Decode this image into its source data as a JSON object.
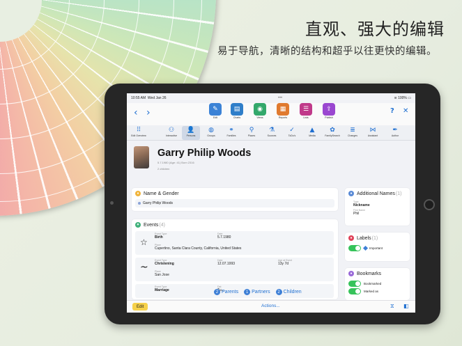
{
  "promo": {
    "headline": "直观、强大的编辑",
    "subline": "易于导航，清晰的结构和超乎以往更快的编辑。"
  },
  "status_bar": {
    "time": "10:55 AM",
    "date": "Wed Jan 26",
    "battery": "100%"
  },
  "toolbar": {
    "items": [
      {
        "label": "Edit",
        "icon": "pencil-icon",
        "color": "#3b82d6"
      },
      {
        "label": "Charts",
        "icon": "chart-icon",
        "color": "#2f7ec9"
      },
      {
        "label": "Views",
        "icon": "eye-icon",
        "color": "#33a86b"
      },
      {
        "label": "Reports",
        "icon": "report-icon",
        "color": "#e07a2f"
      },
      {
        "label": "Lists",
        "icon": "list-icon",
        "color": "#c0398a"
      },
      {
        "label": "Publish",
        "icon": "share-icon",
        "color": "#9a47d0"
      }
    ]
  },
  "tabs": [
    {
      "label": "Edit Overview",
      "icon": "grid-icon"
    },
    {
      "label": "Interactive",
      "icon": "tree-icon"
    },
    {
      "label": "Persons",
      "icon": "person-icon",
      "active": true
    },
    {
      "label": "Groups",
      "icon": "group-icon"
    },
    {
      "label": "Families",
      "icon": "family-icon"
    },
    {
      "label": "Places",
      "icon": "pin-icon"
    },
    {
      "label": "Sources",
      "icon": "source-icon"
    },
    {
      "label": "ToDo's",
      "icon": "check-icon"
    },
    {
      "label": "Media",
      "icon": "media-icon"
    },
    {
      "label": "FamilySearch",
      "icon": "familysearch-icon"
    },
    {
      "label": "Changes",
      "icon": "changes-icon"
    },
    {
      "label": "Assistant",
      "icon": "assistant-icon"
    },
    {
      "label": "Author",
      "icon": "author-icon"
    }
  ],
  "person": {
    "name": "Garry Philip Woods",
    "meta_line1": "5.7.1980 (Age: 41) Born 2316",
    "meta_line2": "2 children"
  },
  "name_gender": {
    "title": "Name & Gender",
    "value": "Garry Philip Woods"
  },
  "events": {
    "title": "Events",
    "count": "(4)",
    "items": [
      {
        "type_key": "Event Type",
        "type": "Birth",
        "date_key": "Date",
        "date": "5.7.1980",
        "place_key": "Place",
        "place": "Cupertino, Santa Clara County, California, United States",
        "icon": "star-icon"
      },
      {
        "type_key": "Event Type",
        "type": "Christening",
        "date_key": "Date",
        "date": "12.07.1993",
        "age_key": "Age at Event",
        "age": "13y 7d",
        "place_key": "Place",
        "place": "San Jose",
        "icon": "tilde-icon"
      },
      {
        "type_key": "Event Type",
        "type": "Marriage",
        "date_key": "Dat",
        "date": "Tu..."
      }
    ]
  },
  "relations": {
    "parents_count": "2",
    "parents_label": "Parents",
    "partners_count": "1",
    "partners_label": "Partners",
    "children_count": "2",
    "children_label": "Children"
  },
  "additional_names": {
    "title": "Additional Names",
    "count": "(1)",
    "type_key": "Type",
    "type": "Nickname",
    "first_key": "First Name",
    "first": "Phil"
  },
  "labels_card": {
    "title": "Labels",
    "count": "(1)",
    "label": "Important"
  },
  "bookmarks": {
    "title": "Bookmarks",
    "row1": "Bookmarked",
    "row2": "Marked as"
  },
  "bottom_bar": {
    "edit": "Edit",
    "actions": "Actions..."
  }
}
